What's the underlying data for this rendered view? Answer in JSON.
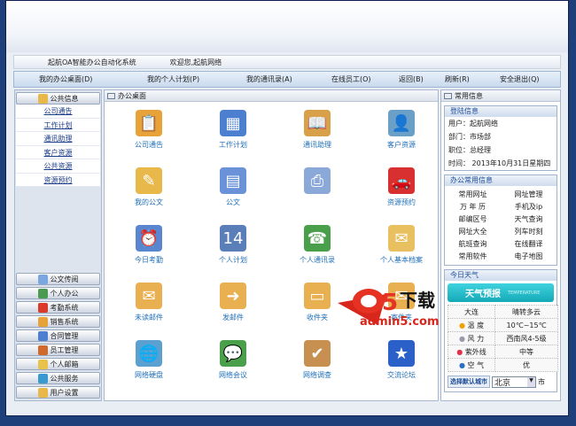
{
  "header": {
    "system_name": "起航OA智能办公自动化系统",
    "welcome": "欢迎您,起航网络"
  },
  "nav": [
    "我的办公桌面(D)",
    "我的个人计划(P)",
    "我的通讯录(A)",
    "在线员工(O)",
    "返回(B)",
    "刷新(R)",
    "安全退出(Q)"
  ],
  "sidebar": {
    "top_button": "公共信息",
    "items": [
      "公司通告",
      "工作计划",
      "通讯助理",
      "客户资源",
      "公共资源",
      "资源预约"
    ],
    "bottom_buttons": [
      {
        "label": "公文传阅",
        "color": "#7aa7e0"
      },
      {
        "label": "个人办公",
        "color": "#4a9a50"
      },
      {
        "label": "考勤系统",
        "color": "#d93a2a"
      },
      {
        "label": "销售系统",
        "color": "#e8a23a"
      },
      {
        "label": "合同管理",
        "color": "#4d7fd0"
      },
      {
        "label": "员工管理",
        "color": "#d06a2a"
      },
      {
        "label": "个人邮箱",
        "color": "#e8c24a"
      },
      {
        "label": "公共服务",
        "color": "#3a9ad0"
      },
      {
        "label": "用户设置",
        "color": "#e8b84a"
      }
    ]
  },
  "main": {
    "title": "办公桌面",
    "tiles": [
      {
        "label": "公司通告",
        "icon": "notice-icon",
        "color": "#e8a23a",
        "glyph": "📋"
      },
      {
        "label": "工作计划",
        "icon": "calendar-icon",
        "color": "#4d7fd0",
        "glyph": "▦"
      },
      {
        "label": "通讯助理",
        "icon": "book-icon",
        "color": "#d9a04a",
        "glyph": "📖"
      },
      {
        "label": "客户资源",
        "icon": "contact-card-icon",
        "color": "#6aa0c8",
        "glyph": "👤"
      },
      {
        "label": "我的公文",
        "icon": "document-edit-icon",
        "color": "#e8b84a",
        "glyph": "✎"
      },
      {
        "label": "公文",
        "icon": "documents-icon",
        "color": "#6a92d8",
        "glyph": "▤"
      },
      {
        "label": "",
        "icon": "printer-icon",
        "color": "#8aa8d8",
        "glyph": "⎙"
      },
      {
        "label": "资源预约",
        "icon": "car-icon",
        "color": "#d83030",
        "glyph": "🚗"
      },
      {
        "label": "今日考勤",
        "icon": "calendar-clock-icon",
        "color": "#5a86d0",
        "glyph": "⏰"
      },
      {
        "label": "个人计划",
        "icon": "calendar-14-icon",
        "color": "#5a7fb8",
        "glyph": "14"
      },
      {
        "label": "个人通讯录",
        "icon": "address-book-icon",
        "color": "#4aa04a",
        "glyph": "☎"
      },
      {
        "label": "个人基本档案",
        "icon": "profile-envelope-icon",
        "color": "#e8c060",
        "glyph": "✉"
      },
      {
        "label": "未读邮件",
        "icon": "unread-mail-icon",
        "color": "#e8b050",
        "glyph": "✉"
      },
      {
        "label": "发邮件",
        "icon": "send-mail-icon",
        "color": "#e8b050",
        "glyph": "➜"
      },
      {
        "label": "收件夹",
        "icon": "inbox-icon",
        "color": "#e8b050",
        "glyph": "▭"
      },
      {
        "label": "寄件夹",
        "icon": "outbox-icon",
        "color": "#e8b050",
        "glyph": "✉"
      },
      {
        "label": "网络硬盘",
        "icon": "network-drive-icon",
        "color": "#5aa0d0",
        "glyph": "🌐"
      },
      {
        "label": "网络会议",
        "icon": "meeting-icon",
        "color": "#4aa04a",
        "glyph": "💬"
      },
      {
        "label": "网络调查",
        "icon": "survey-icon",
        "color": "#c89050",
        "glyph": "✔"
      },
      {
        "label": "交流论坛",
        "icon": "forum-icon",
        "color": "#2a60c8",
        "glyph": "★"
      }
    ],
    "watermark": "a5下载 admin5.com"
  },
  "right": {
    "title": "常用信息",
    "login": {
      "title": "登陆信息",
      "user": "用户：起航网络",
      "dept": "部门：市场部",
      "position": "职位：总经理",
      "time": "时间： 2013年10月31日星期四"
    },
    "office": {
      "title": "办公常用信息",
      "links": [
        "常用网址",
        "网址管理",
        "万 年 历",
        "手机及ip",
        "邮编区号",
        "天气查询",
        "网址大全",
        "列车时刻",
        "航班查询",
        "在线翻译",
        "常用软件",
        "电子地图"
      ]
    },
    "weather": {
      "title": "今日天气",
      "banner": "天气预报",
      "banner_sub": "TEMPERATURE",
      "city": "大连",
      "condition": "晴转多云",
      "rows": [
        {
          "label": "温  度",
          "value": "10℃~15℃",
          "icon": "sun-icon"
        },
        {
          "label": "风  力",
          "value": "西南风4-5级",
          "icon": "wind-icon"
        },
        {
          "label": "紫外线",
          "value": "中等",
          "icon": "uv-icon"
        },
        {
          "label": "空  气",
          "value": "优",
          "icon": "water-drops-icon"
        }
      ],
      "choose_city": "选择默认城市",
      "selected_city": "北京",
      "city_suffix": "市"
    }
  }
}
